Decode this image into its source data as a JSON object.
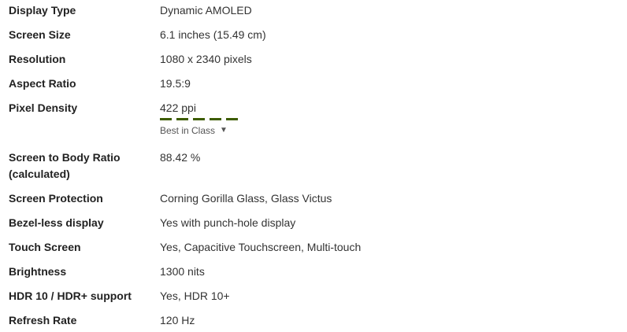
{
  "specs": [
    {
      "label": "Display Type",
      "value": "Dynamic AMOLED"
    },
    {
      "label": "Screen Size",
      "value": "6.1 inches (15.49 cm)"
    },
    {
      "label": "Resolution",
      "value": "1080 x 2340 pixels"
    },
    {
      "label": "Aspect Ratio",
      "value": "19.5:9"
    },
    {
      "label": "Pixel Density",
      "value": "422 ppi",
      "rating_segments": 5,
      "rating_label": "Best in Class",
      "rating_caret": "▼"
    },
    {
      "label": "Screen to Body Ratio (calculated)",
      "value": "88.42 %"
    },
    {
      "label": "Screen Protection",
      "value": "Corning Gorilla Glass, Glass Victus"
    },
    {
      "label": "Bezel-less display",
      "value": "Yes with punch-hole display"
    },
    {
      "label": "Touch Screen",
      "value": "Yes, Capacitive Touchscreen, Multi-touch"
    },
    {
      "label": "Brightness",
      "value": "1300 nits"
    },
    {
      "label": "HDR 10 / HDR+ support",
      "value": "Yes, HDR 10+"
    },
    {
      "label": "Refresh Rate",
      "value": "120 Hz"
    }
  ],
  "colors": {
    "rating_bar": "#3d5c00",
    "label_text": "#222222",
    "value_text": "#333333"
  }
}
